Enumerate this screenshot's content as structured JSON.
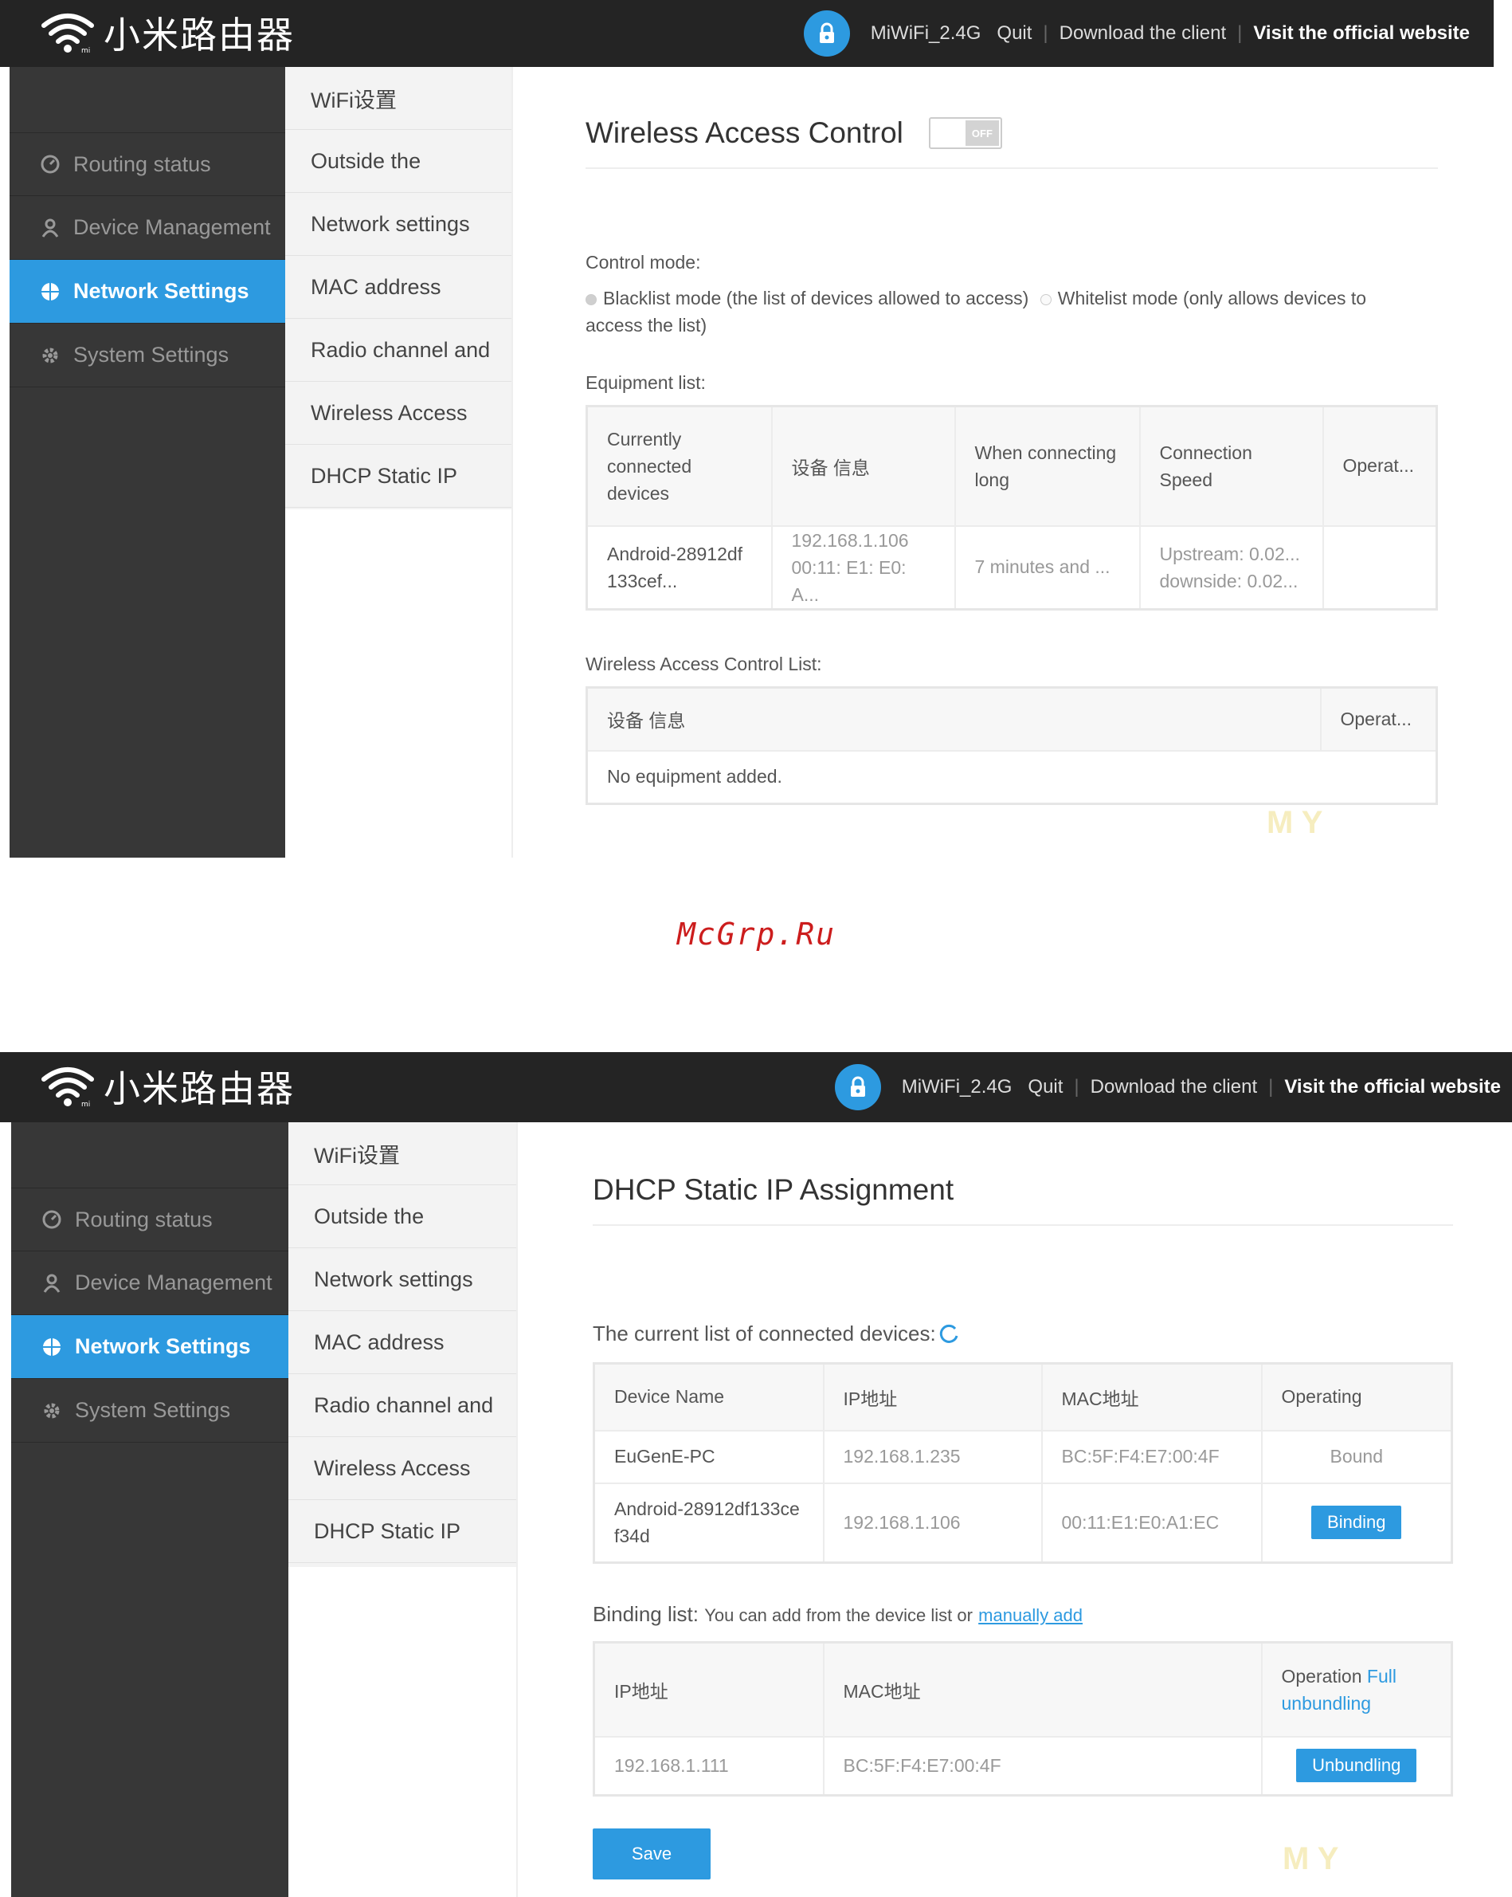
{
  "colors": {
    "accent": "#2d9ae0",
    "topbar": "#242424",
    "sidebar": "#373737",
    "watermark": "#cc1d1d"
  },
  "header": {
    "brand": "小米路由器",
    "network": "MiWiFi_2.4G",
    "quit": "Quit",
    "download": "Download the client",
    "official": "Visit the official website"
  },
  "sidebar": {
    "items": [
      {
        "label": "Routing status",
        "icon": "gauge-icon"
      },
      {
        "label": "Device Management",
        "icon": "user-icon"
      },
      {
        "label": "Network Settings",
        "icon": "globe-icon",
        "active": true
      },
      {
        "label": "System Settings",
        "icon": "gear-icon"
      }
    ]
  },
  "submenu": {
    "items": [
      "WiFi设置",
      "Outside the",
      "Network settings",
      "MAC address",
      "Radio channel and",
      "Wireless Access",
      "DHCP Static IP"
    ]
  },
  "page1": {
    "title": "Wireless Access Control",
    "toggle": "OFF",
    "control_mode_label": "Control mode:",
    "blacklist": "Blacklist mode (the list of devices allowed to access)",
    "whitelist": "Whitelist mode (only allows devices to access the list)",
    "equipment_label": "Equipment list:",
    "equipment_headers": [
      "Currently connected devices",
      "设备 信息",
      "When connecting long",
      "Connection Speed",
      "Operat..."
    ],
    "equipment_rows": [
      {
        "device": "Android-28912df133cef...",
        "info_ip": "192.168.1.106",
        "info_mac": "00:11: E1: E0: A...",
        "time": "7 minutes and ...",
        "up": "Upstream: 0.02...",
        "down": "downside: 0.02..."
      }
    ],
    "acl_label": "Wireless Access Control List:",
    "acl_headers": [
      "设备 信息",
      "Operat..."
    ],
    "acl_empty": "No equipment added."
  },
  "page2": {
    "title": "DHCP Static IP Assignment",
    "current_label": "The current list of connected devices:",
    "device_headers": [
      "Device Name",
      "IP地址",
      "MAC地址",
      "Operating"
    ],
    "devices": [
      {
        "name": "EuGenE-PC",
        "ip": "192.168.1.235",
        "mac": "BC:5F:F4:E7:00:4F",
        "op": "Bound"
      },
      {
        "name": "Android-28912df133cef34d",
        "ip": "192.168.1.106",
        "mac": "00:11:E1:E0:A1:EC",
        "op": "Binding"
      }
    ],
    "binding_label": "Binding list:",
    "binding_hint": "You can add from the device list or",
    "manual_add": "manually add",
    "binding_headers": [
      "IP地址",
      "MAC地址",
      "Operation"
    ],
    "full_unbundling": "Full unbundling",
    "bindings": [
      {
        "ip": "192.168.1.111",
        "mac": "BC:5F:F4:E7:00:4F",
        "op": "Unbundling"
      }
    ],
    "save": "Save"
  },
  "watermark": "McGrp.Ru"
}
